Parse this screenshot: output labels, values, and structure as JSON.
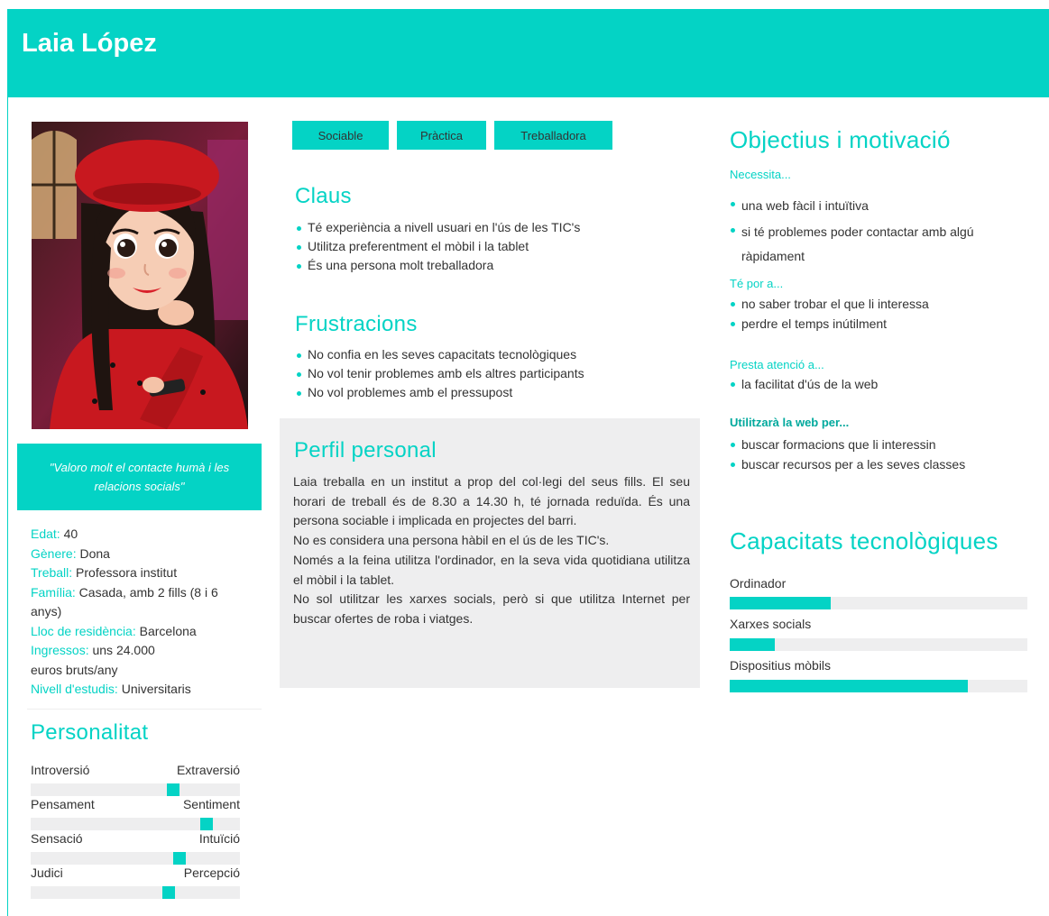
{
  "name": "Laia López",
  "quote": "\"Valoro molt el contacte humà i les relacions socials\"",
  "facts": [
    {
      "key": "Edat:",
      "value": " 40"
    },
    {
      "key": "Gènere:",
      "value": " Dona"
    },
    {
      "key": "Treball:",
      "value": " Professora institut"
    },
    {
      "key": "Família:",
      "value": " Casada, amb 2 fills (8 i 6 anys)"
    },
    {
      "key": "Lloc de residència:",
      "value": " Barcelona"
    },
    {
      "key": "Ingressos:",
      "value": " uns 24.000 euros bruts/any"
    },
    {
      "key": "Nivell d'estudis:",
      "value": " Universitaris"
    }
  ],
  "personality": {
    "title": "Personalitat",
    "scales": [
      {
        "left": "Introversió",
        "right": "Extraversió",
        "level": 0.68
      },
      {
        "left": "Pensament",
        "right": "Sentiment",
        "level": 0.84
      },
      {
        "left": "Sensació",
        "right": "Intuïció",
        "level": 0.71
      },
      {
        "left": "Judici",
        "right": "Percepció",
        "level": 0.66
      }
    ]
  },
  "tags": [
    "Sociable",
    "Pràctica",
    "Treballadora"
  ],
  "claus": {
    "title": "Claus",
    "items": [
      "Té experiència a nivell usuari en l'ús de les TIC's",
      "Utilitza preferentment el mòbil i la tablet",
      "És una persona molt treballadora"
    ]
  },
  "frustracions": {
    "title": "Frustracions",
    "items": [
      "No confia en les seves capacitats tecnològiques",
      "No vol tenir problemes amb els altres participants",
      "No vol problemes amb el pressupost"
    ]
  },
  "perfil": {
    "title": "Perfil personal",
    "paragraphs": [
      "Laia treballa en un institut a prop del col·legi del seus fills. El seu horari de treball és de 8.30 a 14.30 h, té jornada reduïda. És una persona sociable i implicada en projectes del barri.",
      "No es considera una persona hàbil en el ús de les TIC's.",
      "Només a la feina utilitza l'ordinador, en la seva vida quotidiana utilitza el mòbil i la tablet.",
      "No sol utilitzar les xarxes socials, però si que utilitza Internet per buscar ofertes de roba i viatges."
    ]
  },
  "objectius": {
    "title": "Objectius i motivació",
    "necessita_label": "Necessita...",
    "necessita": [
      "una web fàcil i intuïtiva",
      "si té problemes poder contactar amb algú ràpidament"
    ],
    "por_label": "Té por a...",
    "por": [
      "no saber trobar el que li interessa",
      "perdre el temps inútilment"
    ],
    "atencio_label": "Presta atenció a...",
    "atencio": [
      "la facilitat d'ús de la web"
    ],
    "utilitzara_label": "Utilitzarà la web per...",
    "utilitzara": [
      "buscar formacions que li interessin",
      "buscar recursos per a les seves classes"
    ]
  },
  "capacitats": {
    "title": "Capacitats tecnològiques",
    "items": [
      {
        "label": "Ordinador",
        "level": 0.34
      },
      {
        "label": "Xarxes socials",
        "level": 0.15
      },
      {
        "label": "Dispositius mòbils",
        "level": 0.8
      }
    ]
  },
  "colors": {
    "accent": "#04d3c5",
    "panel": "#eeeeef",
    "text": "#333333"
  }
}
